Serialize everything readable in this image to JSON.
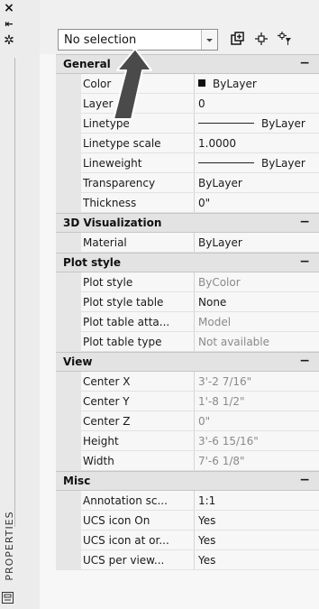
{
  "palette": {
    "title": "PROPERTIES",
    "selection": "No selection"
  },
  "sections": [
    {
      "title": "General",
      "toggle": "−",
      "rows": [
        {
          "name": "Color",
          "value": "ByLayer",
          "swatch": "#111111"
        },
        {
          "name": "Layer",
          "value": "0"
        },
        {
          "name": "Linetype",
          "value": "ByLayer",
          "line": true
        },
        {
          "name": "Linetype scale",
          "value": "1.0000"
        },
        {
          "name": "Lineweight",
          "value": "ByLayer",
          "line": true
        },
        {
          "name": "Transparency",
          "value": "ByLayer"
        },
        {
          "name": "Thickness",
          "value": "0\""
        }
      ]
    },
    {
      "title": "3D Visualization",
      "toggle": "−",
      "rows": [
        {
          "name": "Material",
          "value": "ByLayer"
        }
      ]
    },
    {
      "title": "Plot style",
      "toggle": "−",
      "rows": [
        {
          "name": "Plot style",
          "value": "ByColor",
          "muted": true
        },
        {
          "name": "Plot style table",
          "value": "None"
        },
        {
          "name": "Plot table atta...",
          "value": "Model",
          "muted": true
        },
        {
          "name": "Plot table type",
          "value": "Not available",
          "muted": true
        }
      ]
    },
    {
      "title": "View",
      "toggle": "−",
      "rows": [
        {
          "name": "Center X",
          "value": "3'-2 7/16\"",
          "muted": true
        },
        {
          "name": "Center Y",
          "value": "1'-8 1/2\"",
          "muted": true
        },
        {
          "name": "Center Z",
          "value": "0\"",
          "muted": true
        },
        {
          "name": "Height",
          "value": "3'-6 15/16\"",
          "muted": true
        },
        {
          "name": "Width",
          "value": "7'-6 1/8\"",
          "muted": true
        }
      ]
    },
    {
      "title": "Misc",
      "toggle": "−",
      "rows": [
        {
          "name": "Annotation sc...",
          "value": "1:1"
        },
        {
          "name": "UCS icon On",
          "value": "Yes"
        },
        {
          "name": "UCS icon at or...",
          "value": "Yes"
        },
        {
          "name": "UCS per view...",
          "value": "Yes"
        }
      ]
    }
  ]
}
